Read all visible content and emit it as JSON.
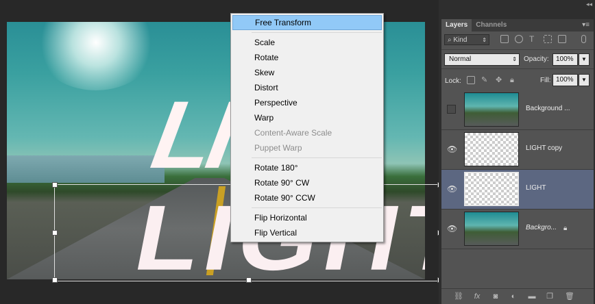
{
  "canvas": {
    "artwork_text_upper": "LIG",
    "artwork_text_lower": "LIGHT"
  },
  "context_menu": {
    "items": [
      {
        "label": "Free Transform",
        "active": true
      },
      {
        "separator": true
      },
      {
        "label": "Scale"
      },
      {
        "label": "Rotate"
      },
      {
        "label": "Skew"
      },
      {
        "label": "Distort"
      },
      {
        "label": "Perspective"
      },
      {
        "label": "Warp"
      },
      {
        "label": "Content-Aware Scale",
        "disabled": true
      },
      {
        "label": "Puppet Warp",
        "disabled": true
      },
      {
        "separator": true
      },
      {
        "label": "Rotate 180°"
      },
      {
        "label": "Rotate 90° CW"
      },
      {
        "label": "Rotate 90° CCW"
      },
      {
        "separator": true
      },
      {
        "label": "Flip Horizontal"
      },
      {
        "label": "Flip Vertical"
      }
    ]
  },
  "panel": {
    "collapse_glyph": "◂◂",
    "menu_glyph": "▾≡",
    "tabs": [
      {
        "label": "Layers",
        "active": true
      },
      {
        "label": "Channels"
      }
    ],
    "filter": {
      "label": "Kind",
      "icon": "search-icon"
    },
    "blend_mode": "Normal",
    "opacity_label": "Opacity:",
    "opacity_value": "100%",
    "lock_label": "Lock:",
    "fill_label": "Fill:",
    "fill_value": "100%",
    "layers": [
      {
        "name": "Background ...",
        "visible": false,
        "thumb": "photo",
        "italic": false,
        "selected": false
      },
      {
        "name": "LIGHT copy",
        "visible": true,
        "thumb": "transparent",
        "italic": false,
        "selected": false
      },
      {
        "name": "LIGHT",
        "visible": true,
        "thumb": "transparent",
        "italic": false,
        "selected": true
      },
      {
        "name": "Backgro...",
        "visible": true,
        "thumb": "photo",
        "italic": true,
        "selected": false,
        "locked": true
      }
    ]
  },
  "colors": {
    "menu_highlight": "#91c9f7",
    "selected_layer": "#5c6781",
    "panel_bg": "#535353"
  }
}
